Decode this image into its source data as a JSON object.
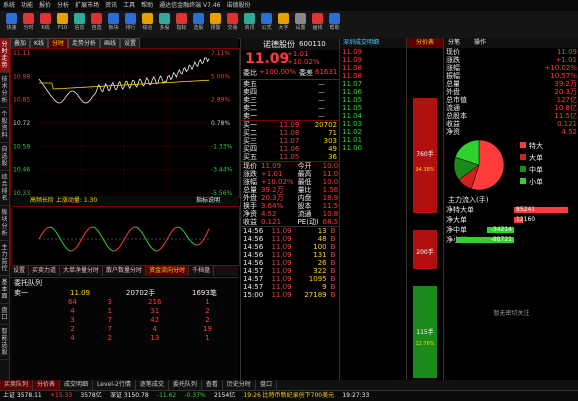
{
  "menu": [
    "系统",
    "功能",
    "报价",
    "分析",
    "扩展市场",
    "资讯",
    "工具",
    "帮助",
    "通达信金融终端 V7.46",
    "诺德股份"
  ],
  "toolbar": [
    {
      "label": "快速",
      "color": "#2a6fd6",
      "icon": "flash-icon"
    },
    {
      "label": "分时",
      "color": "#d33",
      "icon": "timeshare-icon"
    },
    {
      "label": "K线",
      "color": "#d33",
      "icon": "kline-icon"
    },
    {
      "label": "F10",
      "color": "#e8a000",
      "icon": "f10-icon"
    },
    {
      "label": "信息",
      "color": "#3a9",
      "icon": "info-icon"
    },
    {
      "label": "自选",
      "color": "#d33",
      "icon": "favorite-icon"
    },
    {
      "label": "板块",
      "color": "#2a6fd6",
      "icon": "sector-icon"
    },
    {
      "label": "排行",
      "color": "#2a6fd6",
      "icon": "ranking-icon"
    },
    {
      "label": "综合",
      "color": "#e8a000",
      "icon": "composite-icon"
    },
    {
      "label": "多股",
      "color": "#3a9",
      "icon": "multi-stock-icon"
    },
    {
      "label": "指标",
      "color": "#d33",
      "icon": "indicator-icon"
    },
    {
      "label": "选股",
      "color": "#2a6fd6",
      "icon": "stock-picker-icon"
    },
    {
      "label": "预警",
      "color": "#e8a000",
      "icon": "alert-icon"
    },
    {
      "label": "交易",
      "color": "#d33",
      "icon": "trade-icon"
    },
    {
      "label": "资讯",
      "color": "#3a9",
      "icon": "news-icon"
    },
    {
      "label": "公式",
      "color": "#2a6fd6",
      "icon": "formula-icon"
    },
    {
      "label": "大字",
      "color": "#e8a000",
      "icon": "big-font-icon"
    },
    {
      "label": "设置",
      "color": "#888",
      "icon": "settings-icon"
    },
    {
      "label": "画线",
      "color": "#d33",
      "icon": "draw-line-icon"
    },
    {
      "label": "帮助",
      "color": "#2a6fd6",
      "icon": "help-icon"
    }
  ],
  "left_tabs": [
    "分时走势",
    "技术分析",
    "个股资料",
    "自选股",
    "综合排名",
    "板块分析",
    "主力监控",
    "基本面",
    "盘口",
    "智能选股"
  ],
  "chart_tabs": [
    "叠加",
    "K线",
    "分时",
    "走势分析",
    "画线",
    "设置"
  ],
  "right_tabs": [
    "深圳成交明细",
    "分价表",
    "分笔",
    "操作"
  ],
  "price_axis": [
    "11.11",
    "10.98",
    "10.85",
    "10.72",
    "10.59",
    "10.46",
    "10.33"
  ],
  "pct_axis": [
    "7.11%",
    "5.00%",
    "2.89%",
    "0.78%",
    "-1.33%",
    "-3.44%",
    "-5.56%"
  ],
  "macd_label": "高频长阶 上涨动量: 1.30",
  "macd_tag": "指标说明",
  "lower_tabs": [
    "设置",
    "买卖力道",
    "大单净量分时",
    "散户数量分时",
    "资金流向分时",
    "千档盘"
  ],
  "stock": {
    "name": "诺德股份",
    "code": "600110",
    "price": "11.09",
    "change": "+1.01",
    "pct": "+10.02%",
    "weibi": "+100.00%",
    "weicha": "61631"
  },
  "sell_levels": [
    {
      "label": "卖五",
      "price": "—",
      "vol": ""
    },
    {
      "label": "卖四",
      "price": "—",
      "vol": ""
    },
    {
      "label": "卖三",
      "price": "—",
      "vol": ""
    },
    {
      "label": "卖二",
      "price": "—",
      "vol": ""
    },
    {
      "label": "卖一",
      "price": "—",
      "vol": ""
    }
  ],
  "buy_levels": [
    {
      "label": "买一",
      "price": "11.09",
      "vol": "20702"
    },
    {
      "label": "买二",
      "price": "11.08",
      "vol": "71"
    },
    {
      "label": "买三",
      "price": "11.07",
      "vol": "303"
    },
    {
      "label": "买四",
      "price": "11.06",
      "vol": "49"
    },
    {
      "label": "买五",
      "price": "11.05",
      "vol": "36"
    }
  ],
  "summary": [
    {
      "k": "现价",
      "v": "11.09",
      "k2": "今开",
      "v2": "10.08"
    },
    {
      "k": "涨跌",
      "v": "+1.01",
      "k2": "最高",
      "v2": "11.09"
    },
    {
      "k": "涨幅",
      "v": "+10.02%",
      "k2": "最低",
      "v2": "10.02"
    },
    {
      "k": "总量",
      "v": "39.2万",
      "k2": "量比",
      "v2": "1.56"
    },
    {
      "k": "外盘",
      "v": "20.3万",
      "k2": "内盘",
      "v2": "18.9万"
    },
    {
      "k": "换手",
      "v": "3.64%",
      "k2": "股本",
      "v2": "11.5亿"
    },
    {
      "k": "净资",
      "v": "4.52",
      "k2": "流通",
      "v2": "10.8亿"
    },
    {
      "k": "收益",
      "v": "0.121",
      "k2": "PE(动)",
      "v2": "68.5"
    }
  ],
  "ticks": [
    {
      "t": "14:56",
      "p": "11.09",
      "v": "13",
      "d": "B"
    },
    {
      "t": "14:56",
      "p": "11.09",
      "v": "48",
      "d": "B"
    },
    {
      "t": "14:56",
      "p": "11.09",
      "v": "100",
      "d": "B"
    },
    {
      "t": "14:56",
      "p": "11.09",
      "v": "131",
      "d": "B"
    },
    {
      "t": "14:56",
      "p": "11.09",
      "v": "26",
      "d": "B"
    },
    {
      "t": "14:57",
      "p": "11.09",
      "v": "322",
      "d": "B"
    },
    {
      "t": "14:57",
      "p": "11.09",
      "v": "1095",
      "d": "B"
    },
    {
      "t": "14:57",
      "p": "11.09",
      "v": "9",
      "d": "B"
    },
    {
      "t": "15:00",
      "p": "11.09",
      "v": "27189",
      "d": "B"
    }
  ],
  "queue": {
    "title": "委托队列",
    "label": "卖一",
    "price": "11.09",
    "vol": "20702手",
    "count": "1693笔",
    "rows": [
      [
        "64",
        "3",
        "216",
        "1"
      ],
      [
        "4",
        "1",
        "31",
        "2"
      ],
      [
        "3",
        "7",
        "42",
        "2"
      ],
      [
        "2",
        "7",
        "4",
        "19"
      ],
      [
        "4",
        "2",
        "13",
        "1"
      ]
    ]
  },
  "detail_rows": [
    "11.09",
    "11.09",
    "11.08",
    "11.08",
    "11.07",
    "11.06",
    "11.05",
    "11.05",
    "11.04",
    "11.03",
    "11.02",
    "11.01",
    "11.00"
  ],
  "far_right": {
    "items": [
      {
        "k": "现价",
        "v": "11.09"
      },
      {
        "k": "涨跌",
        "v": "+1.01"
      },
      {
        "k": "涨幅",
        "v": "+10.02%"
      },
      {
        "k": "振幅",
        "v": "10.57%"
      },
      {
        "k": "总量",
        "v": "39.2万"
      },
      {
        "k": "外盘",
        "v": "20.3万"
      },
      {
        "k": "总市值",
        "v": "127亿"
      },
      {
        "k": "流通",
        "v": "10.8亿"
      },
      {
        "k": "总股本",
        "v": "11.5亿"
      },
      {
        "k": "收益",
        "v": "0.121"
      },
      {
        "k": "净资",
        "v": "4.52"
      }
    ],
    "pie_legend": [
      "特大",
      "大单",
      "中单",
      "小单"
    ],
    "flow_title": "主力流入(手)",
    "flow": [
      {
        "k": "净特大单",
        "v": "85241",
        "c": "#ff3b3b",
        "f": 0.9
      },
      {
        "k": "净大单",
        "v": "12160",
        "c": "#ff3b3b",
        "f": 0.15
      },
      {
        "k": "净中单",
        "v": "-34214",
        "c": "#2fd12f",
        "f": 0.45
      },
      {
        "k": "净小单",
        "v": "-88721",
        "c": "#2fd12f",
        "f": 0.95
      }
    ],
    "note": "暂无密切关注"
  },
  "depth_bars": [
    {
      "label": "760手",
      "sub": "94.38%",
      "top": 0.15,
      "h": 0.35,
      "c": "#b01010"
    },
    {
      "label": "200手",
      "sub": "",
      "top": 0.55,
      "h": 0.12,
      "c": "#b01010"
    },
    {
      "label": "115手",
      "sub": "12.76%",
      "top": 0.72,
      "h": 0.28,
      "c": "#1a8a1a"
    }
  ],
  "bottom_tabs": [
    "买卖队列",
    "分价表",
    "成交明细",
    "Level-2行情",
    "逐笔成交",
    "委托队列",
    "查看",
    "历史分时",
    "盘口"
  ],
  "status": {
    "sh": "上证 3578.11",
    "sh_chg": "+15.33",
    "sh_vol": "3578亿",
    "sz": "深证 3150.78",
    "sz_chg": "-11.62",
    "sz_pct": "-0.37%",
    "sz_vol": "2154亿",
    "msg": "19:26 比特币新纪录创下700美元",
    "time": "19:27:33"
  },
  "colors": {
    "up": "#ff3b3b",
    "down": "#2fd12f",
    "price": "#ffd400",
    "accent": "#8a1010"
  }
}
